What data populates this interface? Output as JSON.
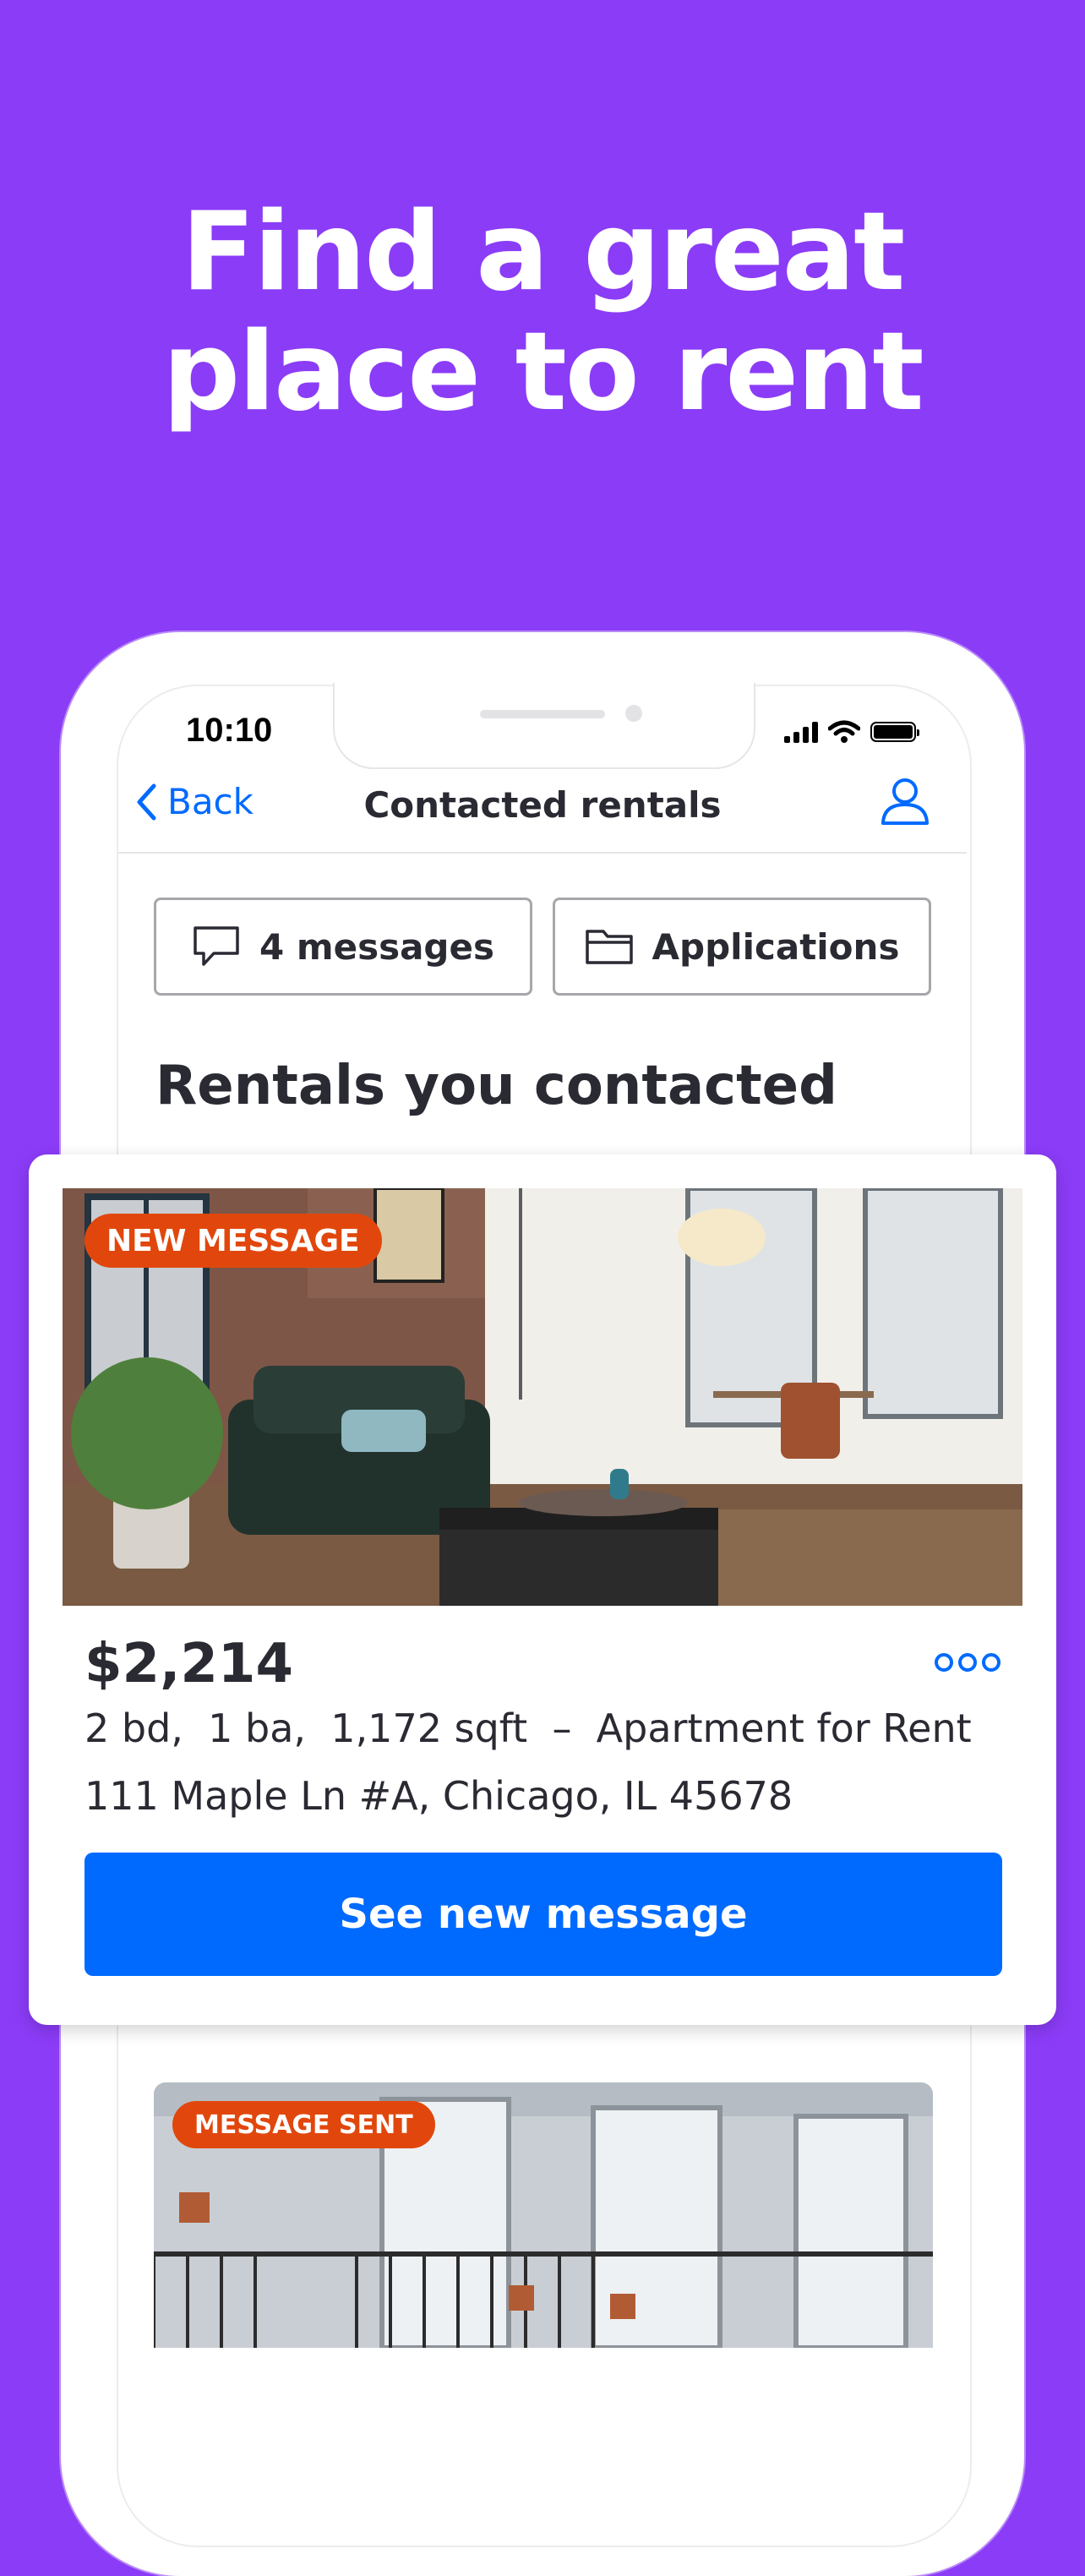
{
  "headline": {
    "line1": "Find a great",
    "line2": "place to rent"
  },
  "status_bar": {
    "time": "10:10"
  },
  "nav": {
    "back_label": "Back",
    "title": "Contacted rentals"
  },
  "filters": {
    "messages_label": "4 messages",
    "applications_label": "Applications"
  },
  "section_title": "Rentals you contacted",
  "listing1": {
    "badge": "NEW MESSAGE",
    "price": "$2,214",
    "specs": "2 bd,  1 ba,  1,172 sqft  –  Apartment for Rent",
    "address": "111 Maple Ln #A, Chicago, IL 45678",
    "cta": "See new message"
  },
  "listing2": {
    "badge": "MESSAGE SENT"
  },
  "colors": {
    "background": "#8b3cf7",
    "accent": "#006aff",
    "badge": "#e1470c",
    "text": "#2a2a33"
  },
  "icons": [
    "chevron-left-icon",
    "user-icon",
    "chat-bubble-icon",
    "folder-icon",
    "more-dots-icon",
    "signal-icon",
    "wifi-icon",
    "battery-icon"
  ]
}
